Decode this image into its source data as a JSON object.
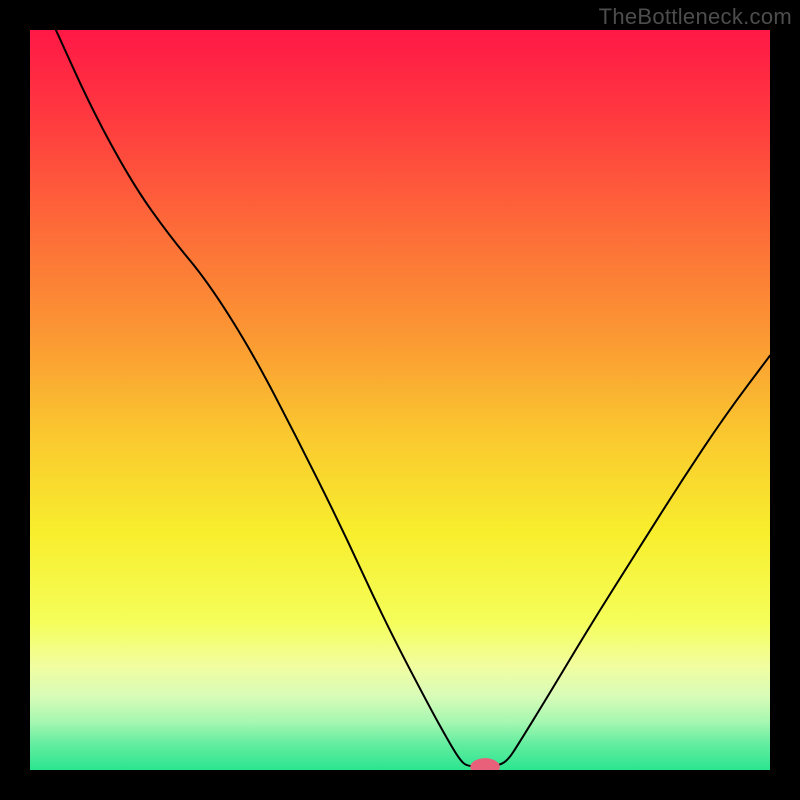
{
  "watermark": "TheBottleneck.com",
  "chart_data": {
    "type": "line",
    "title": "",
    "xlabel": "",
    "ylabel": "",
    "xlim": [
      0,
      1
    ],
    "ylim": [
      0,
      1
    ],
    "grid": false,
    "legend": false,
    "background_gradient_stops": [
      {
        "offset": 0.0,
        "color": "#ff1846"
      },
      {
        "offset": 0.12,
        "color": "#ff3a3f"
      },
      {
        "offset": 0.28,
        "color": "#fd6f38"
      },
      {
        "offset": 0.42,
        "color": "#fb9a33"
      },
      {
        "offset": 0.55,
        "color": "#fac92f"
      },
      {
        "offset": 0.68,
        "color": "#f8ee2d"
      },
      {
        "offset": 0.8,
        "color": "#f5fe5a"
      },
      {
        "offset": 0.86,
        "color": "#f1fda0"
      },
      {
        "offset": 0.9,
        "color": "#d8fcb8"
      },
      {
        "offset": 0.935,
        "color": "#a6f7b1"
      },
      {
        "offset": 0.965,
        "color": "#63eda0"
      },
      {
        "offset": 1.0,
        "color": "#2be58f"
      }
    ],
    "series": [
      {
        "name": "bottleneck-curve",
        "stroke": "#000000",
        "stroke_width": 2,
        "points": [
          {
            "x": 0.035,
            "y": 1.0
          },
          {
            "x": 0.085,
            "y": 0.89
          },
          {
            "x": 0.14,
            "y": 0.79
          },
          {
            "x": 0.19,
            "y": 0.72
          },
          {
            "x": 0.24,
            "y": 0.66
          },
          {
            "x": 0.3,
            "y": 0.565
          },
          {
            "x": 0.36,
            "y": 0.45
          },
          {
            "x": 0.42,
            "y": 0.33
          },
          {
            "x": 0.48,
            "y": 0.2
          },
          {
            "x": 0.54,
            "y": 0.085
          },
          {
            "x": 0.565,
            "y": 0.04
          },
          {
            "x": 0.58,
            "y": 0.015
          },
          {
            "x": 0.59,
            "y": 0.005
          },
          {
            "x": 0.61,
            "y": 0.005
          },
          {
            "x": 0.63,
            "y": 0.005
          },
          {
            "x": 0.645,
            "y": 0.012
          },
          {
            "x": 0.66,
            "y": 0.035
          },
          {
            "x": 0.7,
            "y": 0.1
          },
          {
            "x": 0.76,
            "y": 0.2
          },
          {
            "x": 0.82,
            "y": 0.295
          },
          {
            "x": 0.88,
            "y": 0.39
          },
          {
            "x": 0.94,
            "y": 0.48
          },
          {
            "x": 1.0,
            "y": 0.56
          }
        ]
      }
    ],
    "marker": {
      "name": "optimal-marker",
      "x": 0.615,
      "y": 0.004,
      "rx": 0.02,
      "ry": 0.012,
      "fill": "#e9607a"
    }
  }
}
